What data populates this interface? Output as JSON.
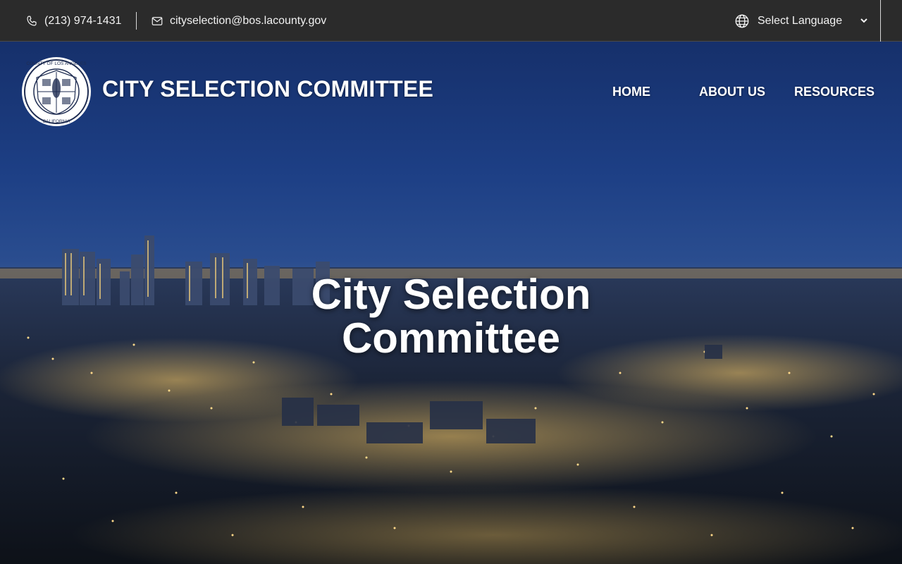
{
  "topbar": {
    "phone": "(213) 974-1431",
    "email": "cityselection@bos.lacounty.gov",
    "language_select": "Select Language",
    "icons": {
      "phone": "phone-icon",
      "email": "envelope-icon",
      "language": "globe-icon",
      "dropdown": "chevron-down-icon"
    }
  },
  "header": {
    "logo_text": {
      "top": "COUNTY OF LOS ANGELES",
      "bottom": "CALIFORNIA"
    },
    "site_title": "CITY SELECTION COMMITTEE",
    "nav": [
      {
        "label": "HOME"
      },
      {
        "label": "ABOUT US"
      },
      {
        "label": "RESOURCES"
      }
    ]
  },
  "hero": {
    "title_line1": "City Selection",
    "title_line2": "Committee"
  },
  "colors": {
    "topbar_bg": "#2b2b2b",
    "text": "#ffffff"
  }
}
